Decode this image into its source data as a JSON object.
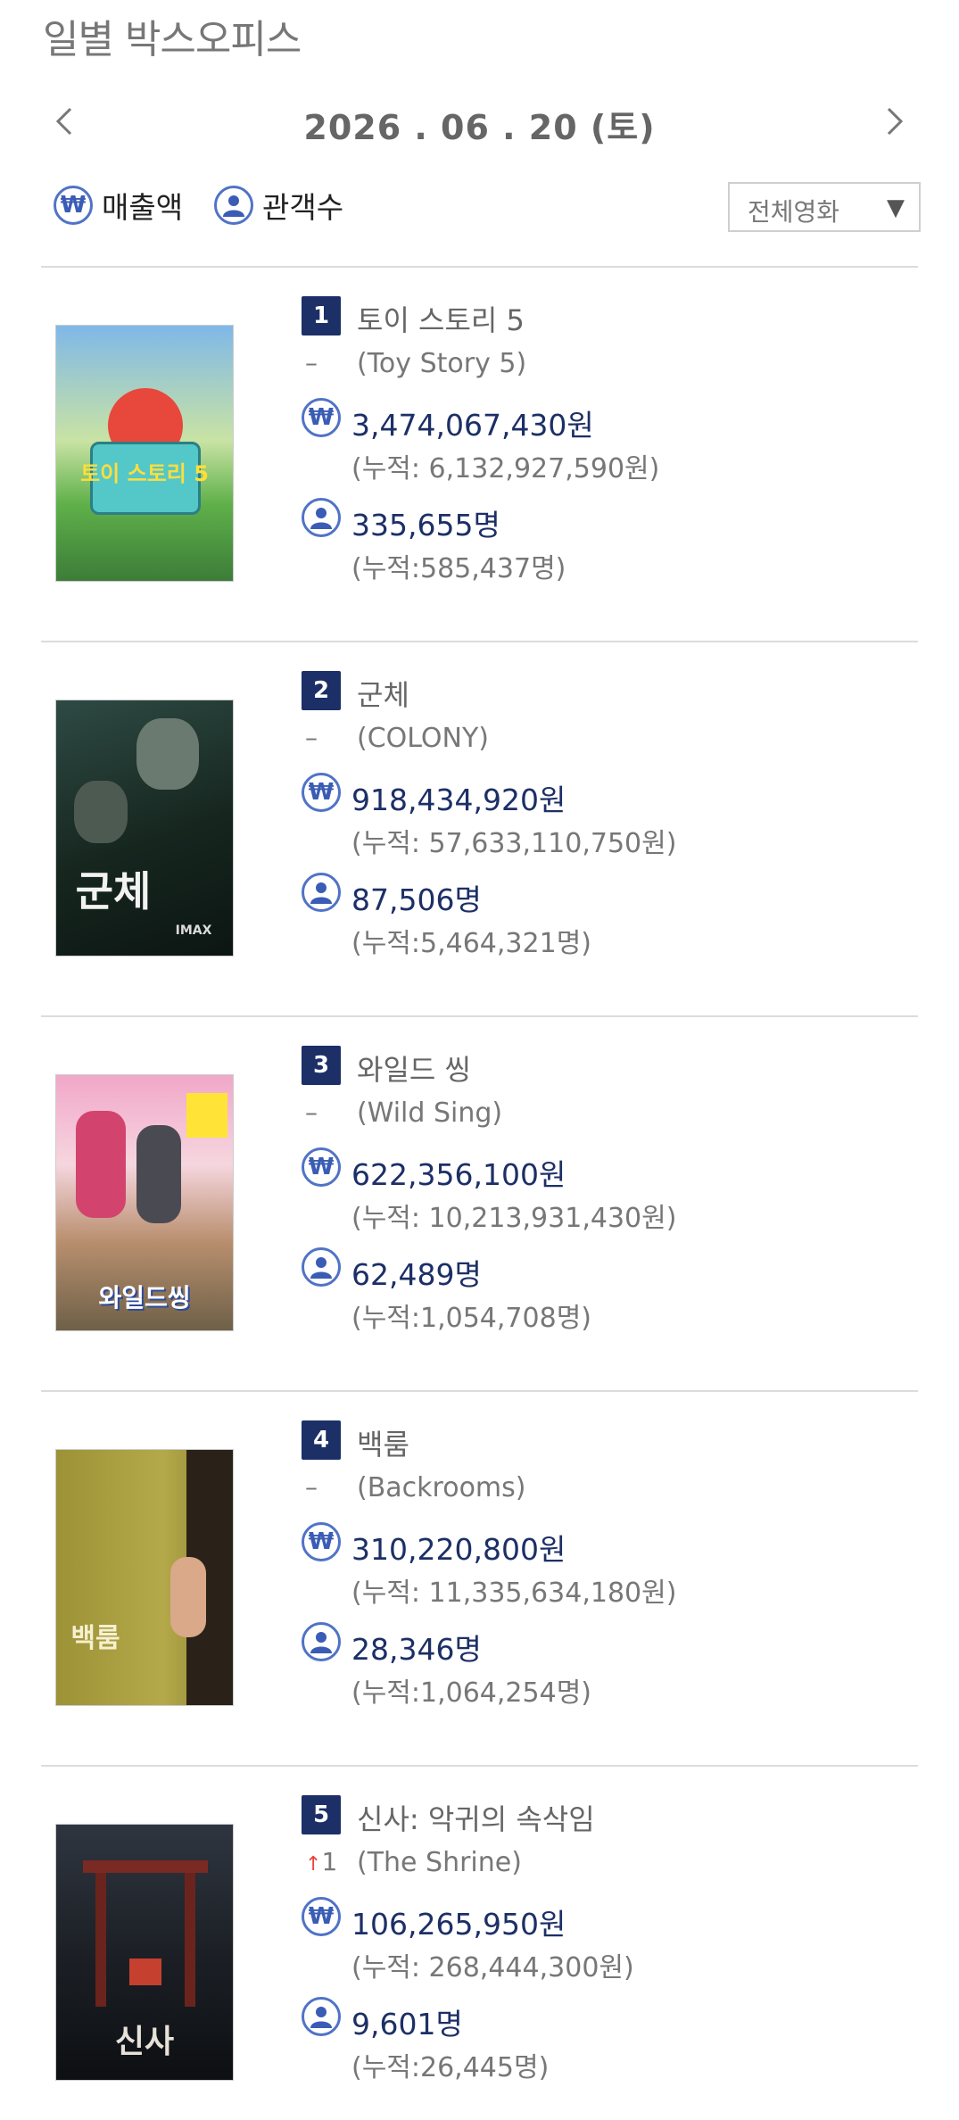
{
  "page": {
    "title": "일별 박스오피스",
    "date": "2026 . 06 . 20  (토)"
  },
  "toggles": {
    "sales_label": "매출액",
    "audience_label": "관객수",
    "sales_icon": "won-icon",
    "audience_icon": "user-icon"
  },
  "filter": {
    "selected": "전체영화"
  },
  "colors": {
    "rank_badge": "#1c2f66",
    "value_text": "#1c2f66",
    "icon_ring": "#5073c6",
    "rank_up": "#e8453c"
  },
  "movies": [
    {
      "rank": "1",
      "title_ko": "토이 스토리 5",
      "rank_change": "–",
      "title_en": "(Toy Story 5)",
      "sales": "3,474,067,430원",
      "sales_cum": "(누적: 6,132,927,590원)",
      "audience": "335,655명",
      "audience_cum": "(누적:585,437명)",
      "poster_text": "토이 스토리 5"
    },
    {
      "rank": "2",
      "title_ko": "군체",
      "rank_change": "–",
      "title_en": "(COLONY)",
      "sales": "918,434,920원",
      "sales_cum": "(누적: 57,633,110,750원)",
      "audience": "87,506명",
      "audience_cum": "(누적:5,464,321명)",
      "poster_text": "군체",
      "poster_sub": "IMAX"
    },
    {
      "rank": "3",
      "title_ko": "와일드 씽",
      "rank_change": "–",
      "title_en": "(Wild Sing)",
      "sales": "622,356,100원",
      "sales_cum": "(누적: 10,213,931,430원)",
      "audience": "62,489명",
      "audience_cum": "(누적:1,054,708명)",
      "poster_text": "와일드씽"
    },
    {
      "rank": "4",
      "title_ko": "백룸",
      "rank_change": "–",
      "title_en": "(Backrooms)",
      "sales": "310,220,800원",
      "sales_cum": "(누적: 11,335,634,180원)",
      "audience": "28,346명",
      "audience_cum": "(누적:1,064,254명)",
      "poster_text": "백룸"
    },
    {
      "rank": "5",
      "title_ko": "신사: 악귀의 속삭임",
      "rank_change_arrow": "↑",
      "rank_change": "1",
      "title_en": "(The Shrine)",
      "sales": "106,265,950원",
      "sales_cum": "(누적: 268,444,300원)",
      "audience": "9,601명",
      "audience_cum": "(누적:26,445명)",
      "poster_text": "신사"
    }
  ]
}
